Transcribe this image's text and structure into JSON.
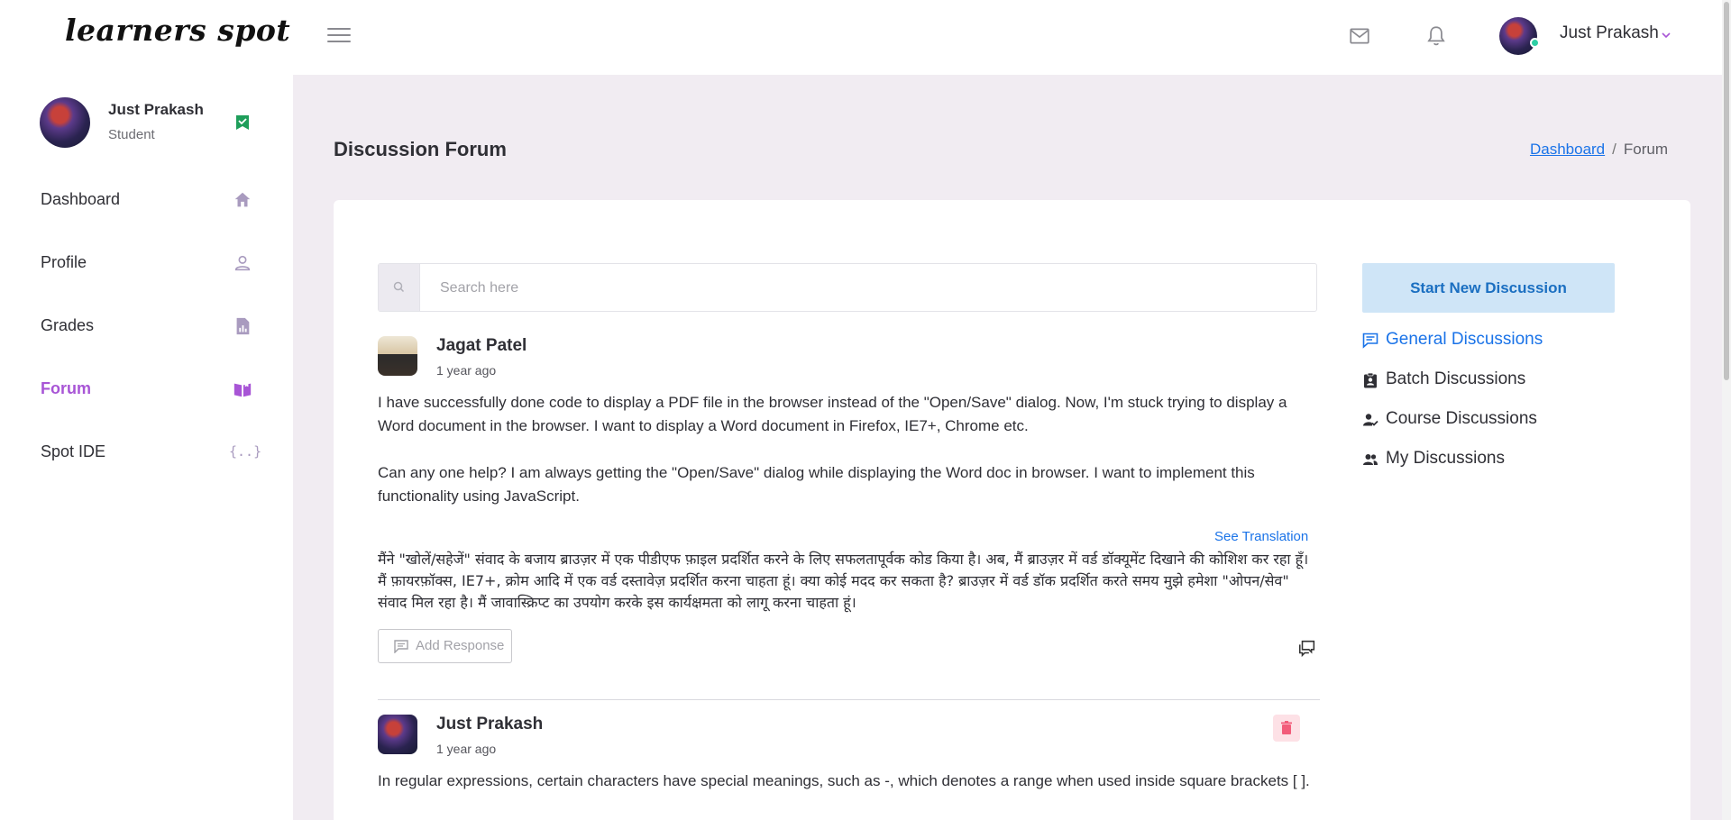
{
  "header": {
    "logo": "learners spot",
    "user_name": "Just Prakash"
  },
  "sidebar": {
    "profile": {
      "name": "Just Prakash",
      "role": "Student"
    },
    "items": [
      {
        "label": "Dashboard",
        "icon": "home-icon"
      },
      {
        "label": "Profile",
        "icon": "user-icon"
      },
      {
        "label": "Grades",
        "icon": "report-icon"
      },
      {
        "label": "Forum",
        "icon": "book-open-icon",
        "active": true
      },
      {
        "label": "Spot IDE",
        "icon": "code-braces-icon"
      }
    ]
  },
  "page": {
    "title": "Discussion Forum",
    "breadcrumb": {
      "link": "Dashboard",
      "current": "Forum"
    }
  },
  "search": {
    "placeholder": "Search here"
  },
  "posts": [
    {
      "author": "Jagat Patel",
      "time": "1 year ago",
      "body_p1": "I have successfully done code to display a PDF file in the browser instead of the \"Open/Save\" dialog. Now, I'm stuck trying to display a Word document in the browser. I want to display a Word document in Firefox, IE7+, Chrome etc.",
      "body_p2": "Can any one help? I am always getting the \"Open/Save\" dialog while displaying the Word doc in browser. I want to implement this functionality using JavaScript.",
      "see_translation": "See Translation",
      "translation": "मैंने \"खोलें/सहेजें\" संवाद के बजाय ब्राउज़र में एक पीडीएफ फ़ाइल प्रदर्शित करने के लिए सफलतापूर्वक कोड किया है। अब, मैं ब्राउज़र में वर्ड डॉक्यूमेंट दिखाने की कोशिश कर रहा हूँ। मैं फ़ायरफ़ॉक्स, IE7+, क्रोम आदि में एक वर्ड दस्तावेज़ प्रदर्शित करना चाहता हूं। क्या कोई मदद कर सकता है? ब्राउज़र में वर्ड डॉक प्रदर्शित करते समय मुझे हमेशा \"ओपन/सेव\" संवाद मिल रहा है। मैं जावास्क्रिप्ट का उपयोग करके इस कार्यक्षमता को लागू करना चाहता हूं।",
      "add_response": "Add Response"
    },
    {
      "author": "Just Prakash",
      "time": "1 year ago",
      "body_p1": "In regular expressions, certain characters have special meanings, such as -, which denotes a range when used inside square brackets [ ]."
    }
  ],
  "right_panel": {
    "start_button": "Start New Discussion",
    "links": [
      {
        "label": "General Discussions",
        "icon": "chat-icon",
        "active": true
      },
      {
        "label": "Batch Discussions",
        "icon": "clipboard-user-icon"
      },
      {
        "label": "Course Discussions",
        "icon": "user-check-icon"
      },
      {
        "label": "My Discussions",
        "icon": "users-icon"
      }
    ]
  },
  "colors": {
    "accent": "#a855d6",
    "link": "#1a73e8",
    "start_button_bg": "#cfe5f7",
    "page_bg": "#f1ecf2"
  }
}
